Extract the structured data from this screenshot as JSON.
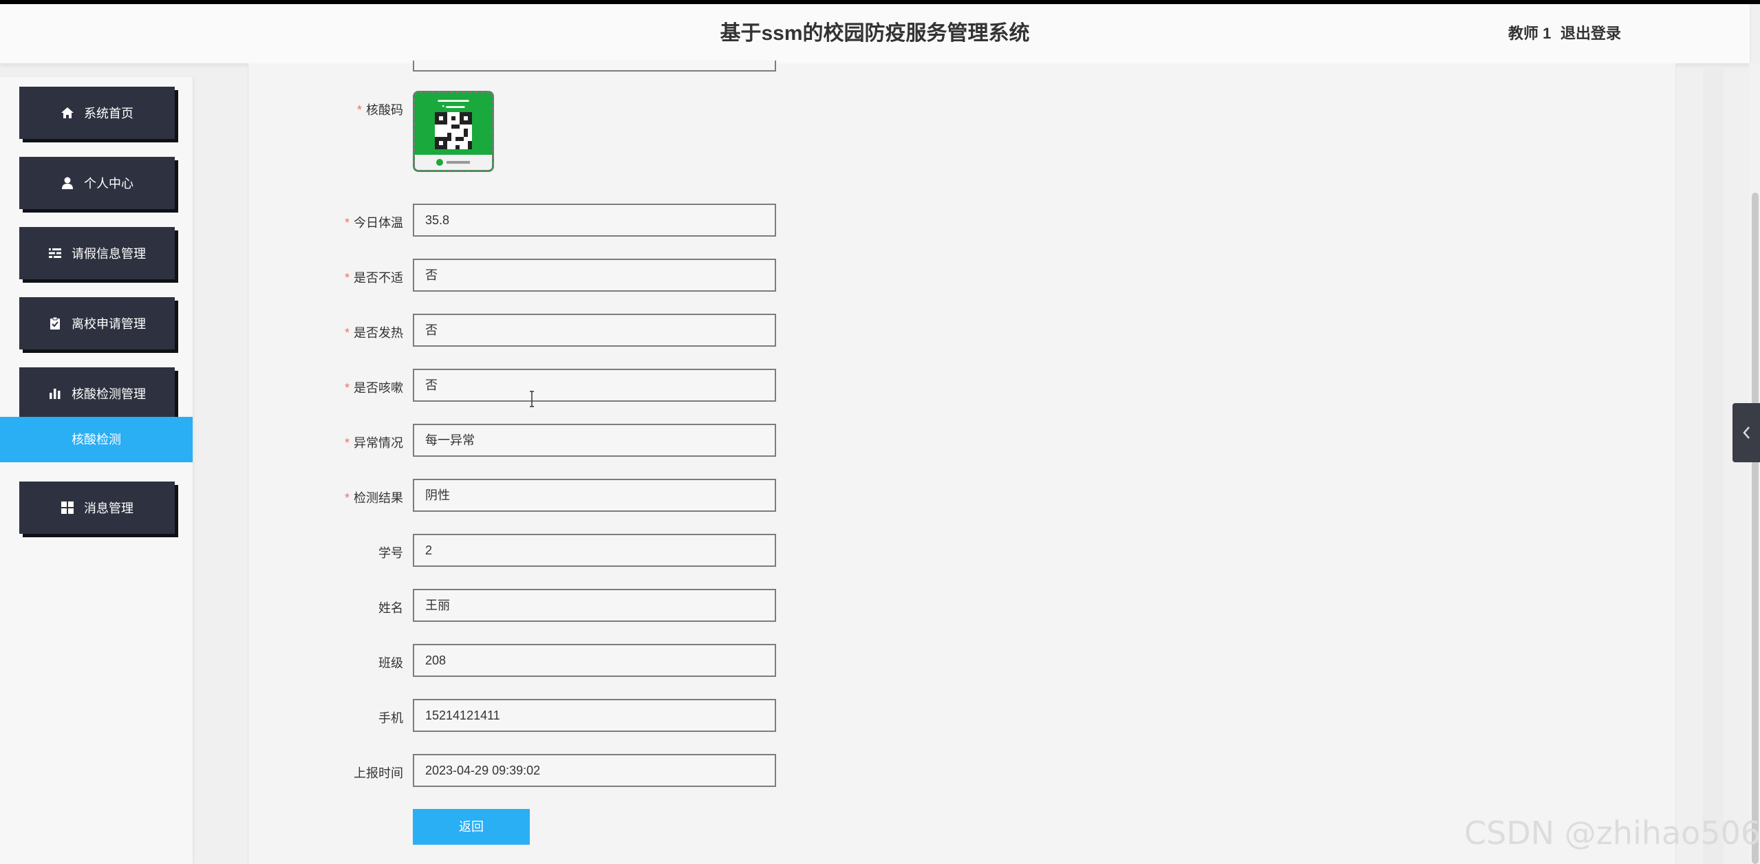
{
  "header": {
    "title": "基于ssm的校园防疫服务管理系统",
    "user": "教师 1",
    "logout": "退出登录"
  },
  "sidebar": {
    "items": [
      {
        "label": "系统首页",
        "icon": "home-icon"
      },
      {
        "label": "个人中心",
        "icon": "user-icon"
      },
      {
        "label": "请假信息管理",
        "icon": "list-icon"
      },
      {
        "label": "离校申请管理",
        "icon": "clipboard-icon"
      },
      {
        "label": "核酸检测管理",
        "icon": "bar-chart-icon"
      },
      {
        "label": "消息管理",
        "icon": "grid-icon"
      }
    ],
    "active_sub": "核酸检测"
  },
  "form": {
    "qr_label": "核酸码",
    "fields": [
      {
        "label": "今日体温",
        "value": "35.8",
        "required": true
      },
      {
        "label": "是否不适",
        "value": "否",
        "required": true
      },
      {
        "label": "是否发热",
        "value": "否",
        "required": true
      },
      {
        "label": "是否咳嗽",
        "value": "否",
        "required": true
      },
      {
        "label": "异常情况",
        "value": "每一异常",
        "required": true
      },
      {
        "label": "检测结果",
        "value": "阴性",
        "required": true
      },
      {
        "label": "学号",
        "value": "2",
        "required": false
      },
      {
        "label": "姓名",
        "value": "王丽",
        "required": false
      },
      {
        "label": "班级",
        "value": "208",
        "required": false
      },
      {
        "label": "手机",
        "value": "15214121411",
        "required": false
      },
      {
        "label": "上报时间",
        "value": "2023-04-29 09:39:02",
        "required": false
      }
    ],
    "return_label": "返回"
  },
  "watermark": "CSDN @zhihao506",
  "colors": {
    "accent": "#2aaef4",
    "menu_bg": "#2e3240",
    "required_star": "#f56c6c",
    "qr_green": "#1aa93d"
  }
}
